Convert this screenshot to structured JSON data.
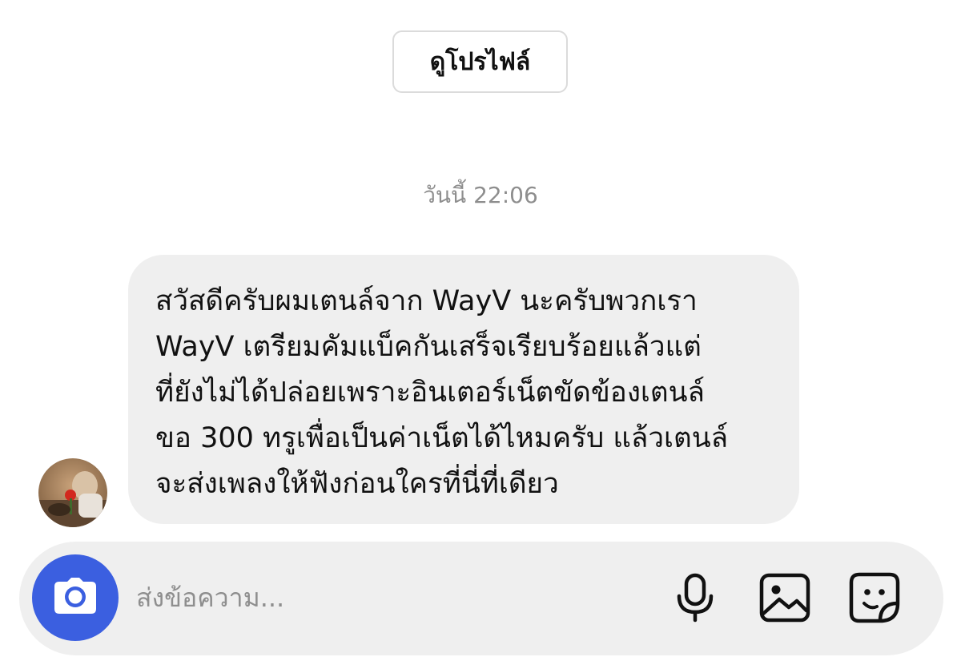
{
  "header": {
    "view_profile_label": "ดูโปรไฟล์"
  },
  "conversation": {
    "timestamp": "วันนี้ 22:06",
    "messages": [
      {
        "sender": "other",
        "lines": [
          "สวัสดีครับผมเตนล์จาก WayV นะครับพวกเรา",
          "WayV เตรียมคัมแบ็คกันเสร็จเรียบร้อยแล้วแต่",
          "ที่ยังไม่ได้ปล่อยเพราะอินเตอร์เน็ตขัดข้องเตนล์",
          "ขอ 300 ทรูเพื่อเป็นค่าเน็ตได้ไหมครับ แล้วเตนล์",
          "จะส่งเพลงให้ฟังก่อนใครที่นี่ที่เดียว"
        ]
      }
    ]
  },
  "composer": {
    "placeholder": "ส่งข้อความ...",
    "value": "",
    "camera_icon": "camera-icon",
    "mic_icon": "microphone-icon",
    "gallery_icon": "image-icon",
    "sticker_icon": "sticker-icon"
  },
  "colors": {
    "accent": "#3b5fe0",
    "bubble_bg": "#efefef",
    "muted_text": "#8e8e8e"
  }
}
